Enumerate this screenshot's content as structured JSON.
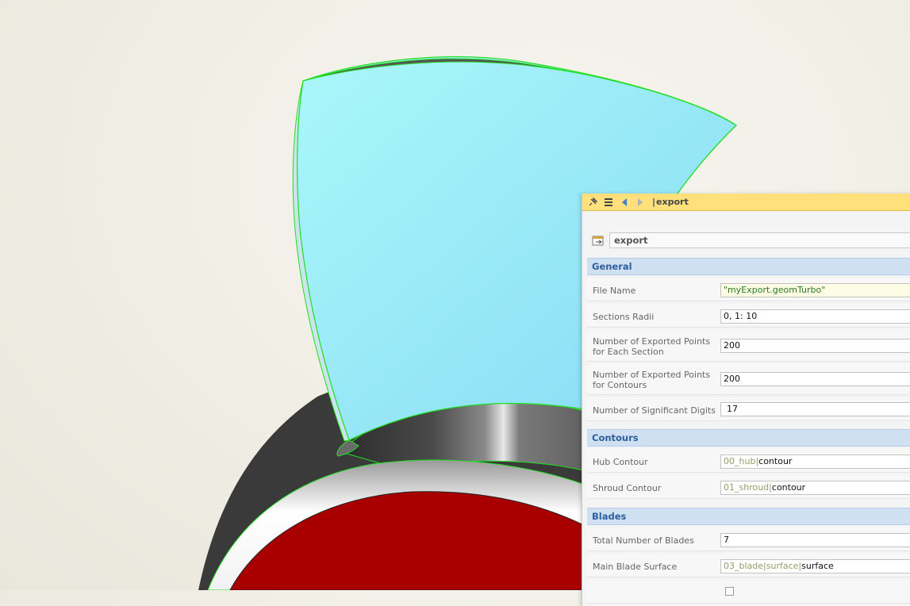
{
  "panel": {
    "title": "export",
    "object_name": "export",
    "icons": [
      "pin-icon",
      "list-icon",
      "back-arrow-icon",
      "forward-arrow-icon"
    ]
  },
  "sections": {
    "general": {
      "header": "General",
      "file_name": {
        "label": "File Name",
        "value": "\"myExport.geomTurbo\""
      },
      "sections_radii": {
        "label": "Sections Radii",
        "value": "0, 1: 10"
      },
      "points_section": {
        "label": "Number of Exported Points for Each Section",
        "value": "200"
      },
      "points_contours": {
        "label": "Number of Exported Points for Contours",
        "value": "200"
      },
      "significant_digits": {
        "label": "Number of Significant Digits",
        "value": "17"
      }
    },
    "contours": {
      "header": "Contours",
      "hub": {
        "label": "Hub Contour",
        "ref": "00_hub",
        "value": "contour"
      },
      "shroud": {
        "label": "Shroud Contour",
        "ref": "01_shroud",
        "value": "contour"
      }
    },
    "blades": {
      "header": "Blades",
      "total": {
        "label": "Total Number of Blades",
        "value": "7"
      },
      "main_surface": {
        "label": "Main Blade Surface",
        "ref1": "03_blade",
        "ref2": "surface",
        "value": "surface"
      }
    }
  },
  "colors": {
    "titlebar": "#ffe07a",
    "section_header": "#cfe0f3",
    "section_text": "#2d5f9e",
    "blade": "#9ae9f9",
    "hub_red": "#a80000",
    "outline_green": "#22dd22"
  }
}
